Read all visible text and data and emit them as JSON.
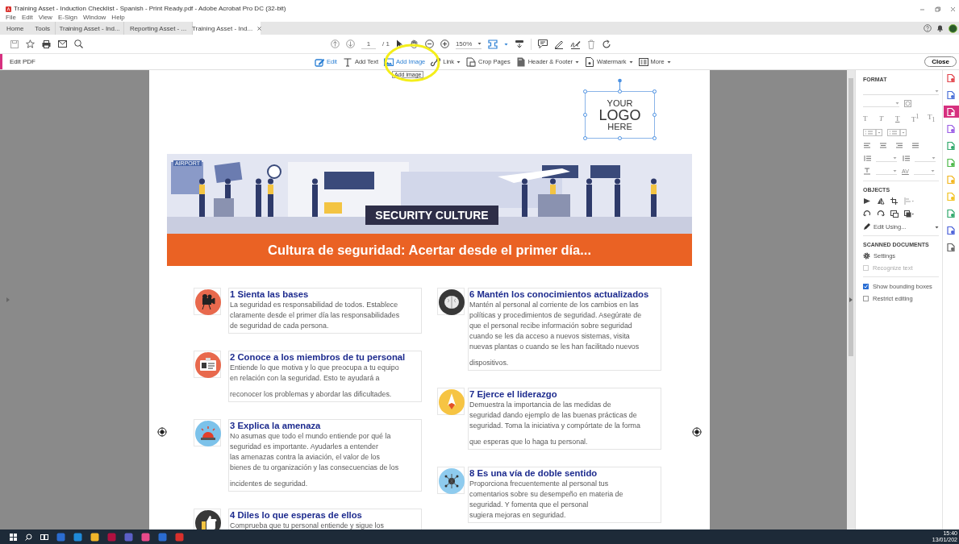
{
  "window": {
    "title": "Training Asset - Induction Checklist - Spanish - Print Ready.pdf - Adobe Acrobat Pro DC (32-bit)"
  },
  "menu": [
    "File",
    "Edit",
    "View",
    "E-Sign",
    "Window",
    "Help"
  ],
  "tabs": [
    {
      "label": "Home",
      "selected": false,
      "kind": "nav"
    },
    {
      "label": "Tools",
      "selected": false,
      "kind": "nav"
    },
    {
      "label": "Training Asset - Ind...",
      "selected": false,
      "kind": "document"
    },
    {
      "label": "Reporting Asset - ...",
      "selected": false,
      "kind": "document"
    },
    {
      "label": "Training Asset - Ind...",
      "selected": true,
      "kind": "document"
    }
  ],
  "toolbar": {
    "page": "1",
    "page_count": "/ 1",
    "zoom": "150%"
  },
  "edit_bar": {
    "title": "Edit PDF",
    "close": "Close",
    "tools": [
      {
        "label": "Edit",
        "dropdown": false,
        "highlighted": true
      },
      {
        "label": "Add Text",
        "dropdown": false,
        "highlighted": false
      },
      {
        "label": "Add Image",
        "dropdown": false,
        "highlighted": true
      },
      {
        "label": "Link",
        "dropdown": true,
        "highlighted": false
      },
      {
        "label": "Crop Pages",
        "dropdown": false,
        "highlighted": false
      },
      {
        "label": "Header & Footer",
        "dropdown": true,
        "highlighted": false
      },
      {
        "label": "Watermark",
        "dropdown": true,
        "highlighted": false
      },
      {
        "label": "More",
        "dropdown": true,
        "highlighted": false
      }
    ]
  },
  "tooltip": "Add image",
  "document": {
    "logo": [
      "YOUR",
      "LOGO",
      "HERE"
    ],
    "banner": {
      "sign": "AIRPORT",
      "caption": "SECURITY CULTURE"
    },
    "headline": "Cultura de seguridad: Acertar desde el primer día...",
    "columns": [
      [
        {
          "title": "1 Sienta las bases",
          "color": "#e8694d",
          "paragraphs": [
            "La seguridad es responsabilidad de todos. Establece\nclaramente desde el primer día las responsabilidades\nde seguridad de cada persona."
          ]
        },
        {
          "title": "2 Conoce a los miembros de tu personal",
          "color": "#e8694d",
          "paragraphs": [
            "Entiende lo que motiva y lo que preocupa a tu equipo\nen relación con la seguridad. Esto te ayudará a",
            "reconocer los problemas y abordar las dificultades."
          ]
        },
        {
          "title": "3 Explica la amenaza",
          "color": "#7cc2ea",
          "paragraphs": [
            "No asumas que todo el mundo entiende por qué la\nseguridad es importante. Ayudarles a entender\nlas amenazas contra la aviación, el valor de los\nbienes de tu organización y las consecuencias de los",
            "incidentes de seguridad."
          ]
        },
        {
          "title": "4 Diles lo que esperas de ellos",
          "color": "#383838",
          "paragraphs": [
            "Comprueba que tu personal entiende y sigue los"
          ]
        }
      ],
      [
        {
          "title": "6 Mantén los conocimientos actualizados",
          "color": "#383838",
          "paragraphs": [
            "Mantén al personal al corriente de los cambios en las\npolíticas y procedimientos de seguridad. Asegúrate de\nque el personal recibe información sobre seguridad\ncuando se les da acceso a nuevos sistemas, visita\nnuevas plantas o cuando se les han facilitado nuevos",
            "dispositivos."
          ]
        },
        {
          "title": "7 Ejerce el liderazgo",
          "color": "#f6c443",
          "paragraphs": [
            "Demuestra la importancia de las medidas de\nseguridad dando ejemplo de las buenas prácticas de\nseguridad. Toma la iniciativa y compórtate de la forma",
            "que esperas que lo haga tu personal."
          ]
        },
        {
          "title": "8 Es una vía de doble sentido",
          "color": "#8ecbee",
          "paragraphs": [
            "Proporciona frecuentemente al personal tus\ncomentarios sobre su desempeño en materia de\nseguridad. Y fomenta que el personal\nsugiera mejoras en seguridad."
          ]
        }
      ]
    ]
  },
  "format_panel": {
    "heading": "FORMAT",
    "style_buttons": [
      "T",
      "T",
      "T",
      "T$^{1}$",
      "T$_{1}$"
    ],
    "char_spacing": "AV",
    "objects_heading": "OBJECTS",
    "edit_using": "Edit Using...",
    "scanned_heading": "SCANNED DOCUMENTS",
    "settings": "Settings",
    "recognize": {
      "label": "Recognize text",
      "checked": false,
      "disabled": true
    },
    "view_options": [
      {
        "label": "Show bounding boxes",
        "checked": true,
        "disabled": false
      },
      {
        "label": "Restrict editing",
        "checked": false,
        "disabled": false
      }
    ]
  },
  "tool_strip": [
    {
      "color": "#e2434b",
      "selected": false
    },
    {
      "color": "#4a6fd8",
      "selected": false
    },
    {
      "color": "#ffffff",
      "selected": true
    },
    {
      "color": "#9b5de5",
      "selected": false
    },
    {
      "color": "#2fa86b",
      "selected": false
    },
    {
      "color": "#4cb848",
      "selected": false
    },
    {
      "color": "#f2b51d",
      "selected": false
    },
    {
      "color": "#f2c21d",
      "selected": false
    },
    {
      "color": "#2fa86b",
      "selected": false
    },
    {
      "color": "#4a5fd8",
      "selected": false
    },
    {
      "color": "#666666",
      "selected": false
    }
  ],
  "taskbar": {
    "time": "15:40",
    "date": "13/01/202"
  }
}
